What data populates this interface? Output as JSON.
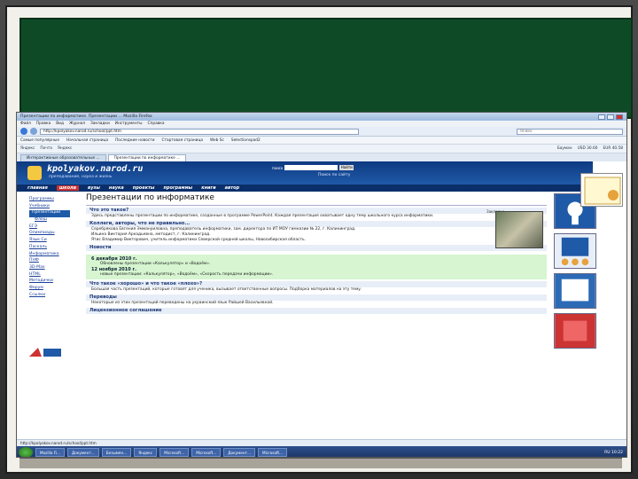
{
  "browser": {
    "title": "Презентации по информатике. Презентации ... Mozilla Firefox",
    "menu": [
      "Файл",
      "Правка",
      "Вид",
      "Журнал",
      "Закладки",
      "Инструменты",
      "Справка"
    ],
    "url": "http://kpolyakov.narod.ru/school/ppt.htm",
    "search_placeholder": "Яndex",
    "bookmarks": [
      "Самые популярные",
      "Начальная страница",
      "Последние новости",
      "Стартовая страница",
      "Web Sc",
      "Selectionspad2"
    ],
    "toolbar2_items": [
      "Яндекс",
      "Почта",
      "Яндекс"
    ],
    "rates": [
      "Бауман",
      "USD 30.60",
      "EUR 40.58"
    ],
    "tabs": [
      {
        "label": "Интерактивные образовательные ...",
        "active": false
      },
      {
        "label": "Презентации по информатике ...",
        "active": true
      }
    ],
    "status": "http://kpolyakov.narod.ru/school/ppt.htm"
  },
  "site": {
    "title": "kpolyakov.narod.ru",
    "subtitle": "преподавание, наука и жизнь",
    "search_label": "поиск",
    "search_button": "Найти",
    "cloud_label": "Поиск по сайту",
    "nav": [
      {
        "label": "главная",
        "active": false
      },
      {
        "label": "школа",
        "active": true
      },
      {
        "label": "вузы",
        "active": false
      },
      {
        "label": "наука",
        "active": false
      },
      {
        "label": "проекты",
        "active": false
      },
      {
        "label": "программы",
        "active": false
      },
      {
        "label": "книги",
        "active": false
      },
      {
        "label": "автор",
        "active": false
      }
    ],
    "sidebar": [
      {
        "label": "Программы",
        "active": false,
        "sub": false
      },
      {
        "label": "Учебники",
        "active": false,
        "sub": false
      },
      {
        "label": "Презентации",
        "active": true,
        "sub": false
      },
      {
        "label": "Флеш",
        "active": false,
        "sub": true
      },
      {
        "label": "ЕГЭ",
        "active": false,
        "sub": false
      },
      {
        "label": "Олимпиады",
        "active": false,
        "sub": false
      },
      {
        "label": "Язык Си",
        "active": false,
        "sub": false
      },
      {
        "label": "Паскаль",
        "active": false,
        "sub": false
      },
      {
        "label": "Информатика",
        "active": false,
        "sub": false
      },
      {
        "label": "ПНФ",
        "active": false,
        "sub": false
      },
      {
        "label": "3D-Max",
        "active": false,
        "sub": false
      },
      {
        "label": "HTML",
        "active": false,
        "sub": false
      },
      {
        "label": "Методички",
        "active": false,
        "sub": false
      },
      {
        "label": "Форум",
        "active": false,
        "sub": false
      },
      {
        "label": "Ссылки",
        "active": false,
        "sub": false
      }
    ],
    "heading": "Презентации по информатике",
    "share": "Закладки",
    "sections": {
      "what": {
        "title": "Что это такое?",
        "text": "Здесь представлены презентации по информатике, созданные в программе PowerPoint. Каждая презентация охватывает одну тему школьного курса информатики."
      },
      "authors": {
        "title": "Коллеги, авторы, что не правильно...",
        "lines": [
          "Серебрякова Евгения Эммануиловна, преподаватель информатики, зам. директора по ИТ МОУ гимназии № 22, г. Калининград.",
          "Ильина Виктория Аркадьевна, методист, г. Калининград.",
          "Ятис Владимир Викторович, учитель информатики Северской средней школы, Новосибирская область."
        ]
      },
      "news": {
        "title": "Новости",
        "items": [
          {
            "date": "6 декабря 2010 г.",
            "text": "Обновлены презентации «Калькулятор» и «Водоём»."
          },
          {
            "date": "12 ноября 2010 г.",
            "text": "новые презентации: «Калькулятор», «Водоём», «Скорость передачи информации»."
          }
        ]
      },
      "good": {
        "title": "Что такое «хорошо» и что такое «плохо»?",
        "text": "Большая часть презентаций, которые готовят для ученика, вызывает ответственные вопросы. Подборка материалов на эту тему."
      },
      "translations": {
        "title": "Переводы",
        "text": "Некоторые из этих презентаций переведены на украинский язык Райшей Васильевной."
      },
      "license": {
        "title": "Лицензионное соглашение"
      }
    }
  },
  "taskbar": {
    "items": [
      "",
      "Mozilla Fi...",
      "Документ...",
      "Безымян...",
      "Яндекс",
      "Microsoft...",
      "Microsoft...",
      "Документ...",
      "Microsoft..."
    ],
    "tray": "RU 10:22"
  }
}
